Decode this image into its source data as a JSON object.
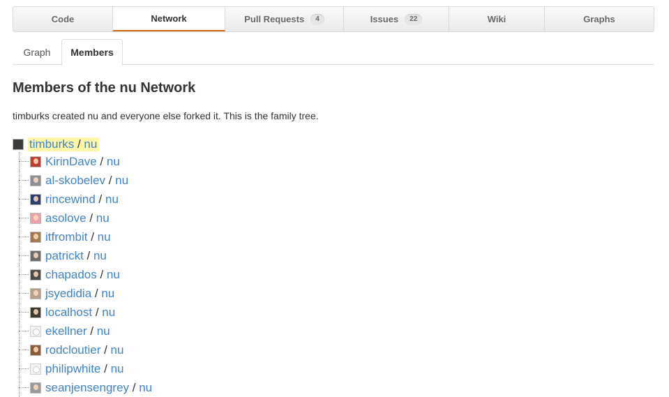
{
  "tabs": [
    {
      "label": "Code",
      "count": null
    },
    {
      "label": "Network",
      "count": null
    },
    {
      "label": "Pull Requests",
      "count": "4"
    },
    {
      "label": "Issues",
      "count": "22"
    },
    {
      "label": "Wiki",
      "count": null
    },
    {
      "label": "Graphs",
      "count": null
    }
  ],
  "active_tab": "Network",
  "subtabs": {
    "graph": "Graph",
    "members": "Members"
  },
  "active_subtab": "Members",
  "title": "Members of the nu Network",
  "description": "timburks created nu and everyone else forked it. This is the family tree.",
  "root": {
    "user": "timburks",
    "separator": " / ",
    "repo": "nu"
  },
  "members": [
    {
      "user": "KirinDave",
      "repo": "nu",
      "avatar_color": "#b8402f"
    },
    {
      "user": "al-skobelev",
      "repo": "nu",
      "avatar_color": "#8a8f98"
    },
    {
      "user": "rincewind",
      "repo": "nu",
      "avatar_color": "#2d3f6e"
    },
    {
      "user": "asolove",
      "repo": "nu",
      "avatar_color": "#e9a3a8"
    },
    {
      "user": "itfrombit",
      "repo": "nu",
      "avatar_color": "#a27a4f"
    },
    {
      "user": "patrickt",
      "repo": "nu",
      "avatar_color": "#6c6c6c"
    },
    {
      "user": "chapados",
      "repo": "nu",
      "avatar_color": "#4a4a4a"
    },
    {
      "user": "jsyedidia",
      "repo": "nu",
      "avatar_color": "#b5a08c"
    },
    {
      "user": "localhost",
      "repo": "nu",
      "avatar_color": "#3e3a30"
    },
    {
      "user": "ekellner",
      "repo": "nu",
      "avatar_color": "ghost"
    },
    {
      "user": "rodcloutier",
      "repo": "nu",
      "avatar_color": "#8d5a3b"
    },
    {
      "user": "philipwhite",
      "repo": "nu",
      "avatar_color": "ghost"
    },
    {
      "user": "seanjensengrey",
      "repo": "nu",
      "avatar_color": "#9a9a9a"
    }
  ],
  "colors": {
    "link": "#4183c4",
    "active_tab_underline": "#d26911",
    "highlight": "#fff8a8"
  }
}
